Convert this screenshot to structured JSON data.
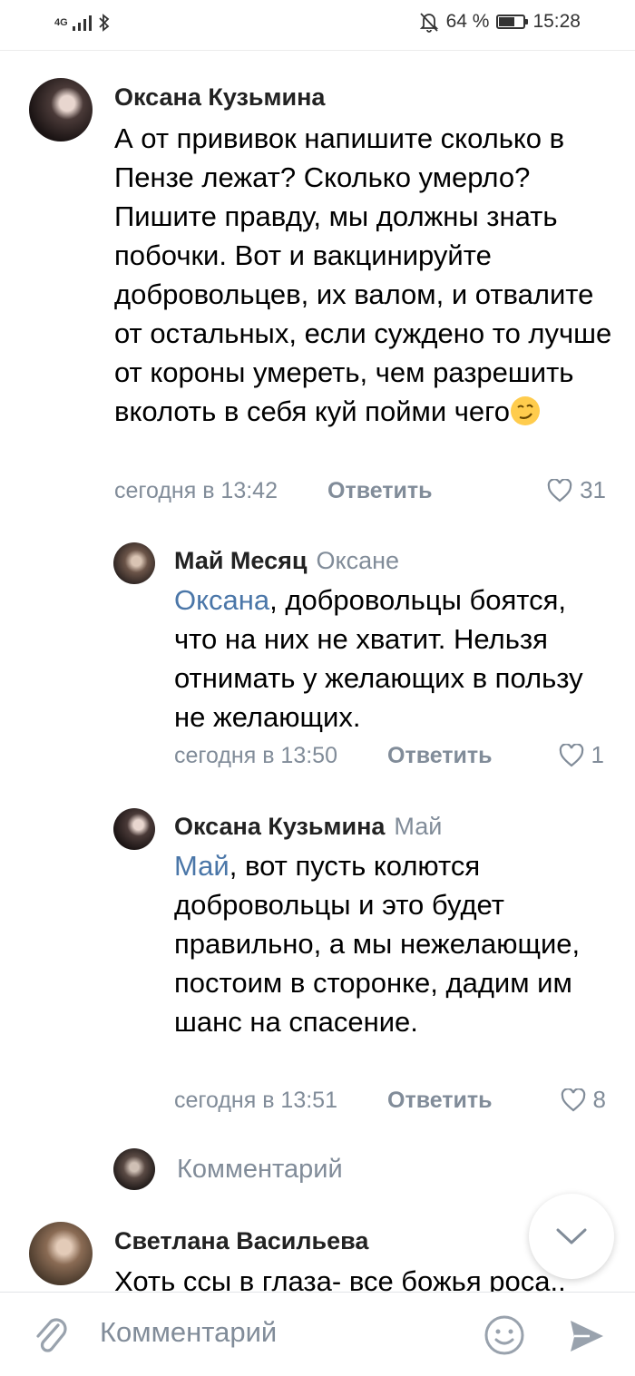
{
  "status_bar": {
    "network": "4G",
    "battery_percent": "64 %",
    "battery_level": 0.64,
    "time": "15:28"
  },
  "comments": [
    {
      "author": "Оксана Кузьмина",
      "text": "А от прививок напишите сколько в Пензе лежат? Сколько умерло? Пишите правду, мы должны знать побочки. Вот и вакцинируйте добровольцев, их валом, и отвалите от остальных, если суждено то лучше от короны умереть, чем разрешить вколоть в себя куй пойми чего",
      "emoji": "smirking-face",
      "time": "сегодня в 13:42",
      "reply_label": "Ответить",
      "likes": "31"
    },
    {
      "author": "Май Месяц",
      "reply_to": "Оксане",
      "mention": "Оксана",
      "text": ", добровольцы боятся, что на них не хватит. Нельзя отнимать у желающих в пользу не желающих.",
      "time": "сегодня в 13:50",
      "reply_label": "Ответить",
      "likes": "1"
    },
    {
      "author": "Оксана Кузьмина",
      "reply_to": "Май",
      "mention": "Май",
      "text": ", вот пусть колются добровольцы и это будет правильно, а мы нежелающие, постоим в сторонке, дадим им шанс на спасение.",
      "time": "сегодня в 13:51",
      "reply_label": "Ответить",
      "likes": "8"
    },
    {
      "author": "Светлана Васильева",
      "text": "Хоть ссы в глаза- все божья роса.."
    }
  ],
  "reply_composer": {
    "placeholder": "Комментарий"
  },
  "bottom_bar": {
    "placeholder": "Комментарий"
  },
  "colors": {
    "link": "#4a76a8",
    "secondary": "#818c99"
  }
}
